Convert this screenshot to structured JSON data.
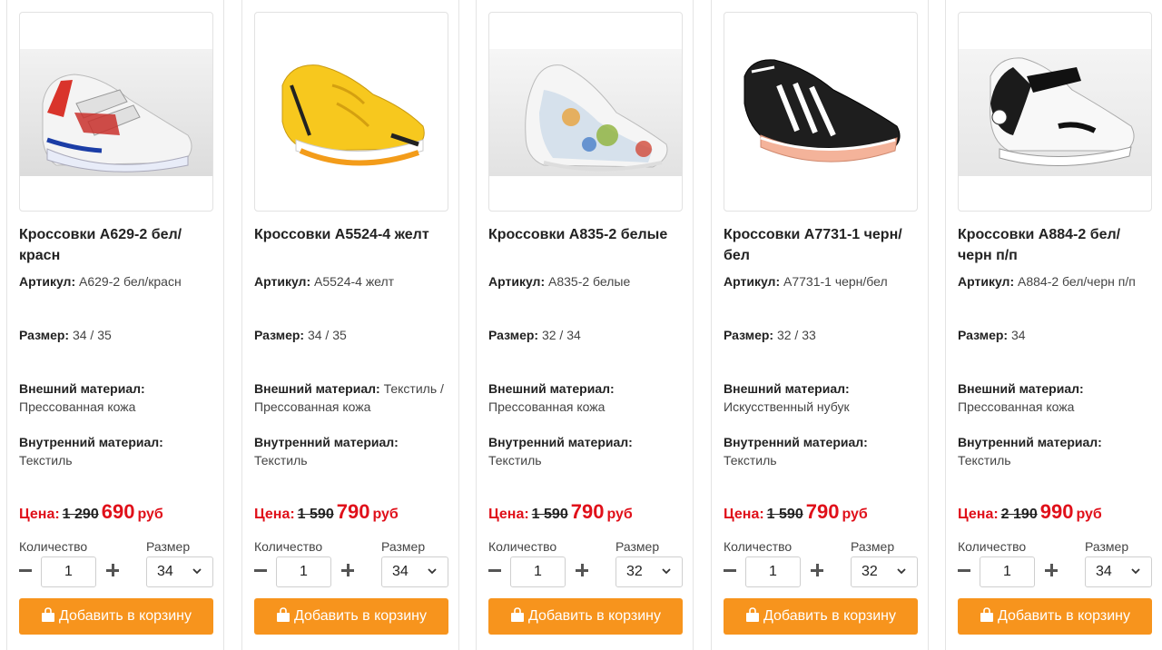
{
  "labels": {
    "article": "Артикул:",
    "size": "Размер:",
    "outer": "Внешний материал:",
    "inner": "Внутренний материал:",
    "price": "Цена:",
    "currency": "руб",
    "qty_label": "Количество",
    "size_label": "Размер",
    "cart_button": "Добавить в корзину"
  },
  "colors": {
    "accent": "#f7941d",
    "price_red": "#e0101a"
  },
  "products": [
    {
      "title": "Кроссовки А629-2 бел/красн",
      "article": "А629-2 бел/красн",
      "sizes": "34 / 35",
      "outer": "Прессованная кожа",
      "inner": "Текстиль",
      "old_price": "1 290",
      "new_price": "690",
      "quantity": "1",
      "selected_size": "34",
      "image": "white-red-velcro-sneaker"
    },
    {
      "title": "Кроссовки А5524-4 желт",
      "article": "А5524-4 желт",
      "sizes": "34 / 35",
      "outer": "Текстиль / Прессованная кожа",
      "inner": "Текстиль",
      "old_price": "1 590",
      "new_price": "790",
      "quantity": "1",
      "selected_size": "34",
      "image": "yellow-sneaker"
    },
    {
      "title": "Кроссовки А835-2 белые",
      "article": "А835-2 белые",
      "sizes": "32 / 34",
      "outer": "Прессованная кожа",
      "inner": "Текстиль",
      "old_price": "1 590",
      "new_price": "790",
      "quantity": "1",
      "selected_size": "32",
      "image": "graffiti-white-sneaker"
    },
    {
      "title": "Кроссовки А7731-1 черн/бел",
      "article": "А7731-1 черн/бел",
      "sizes": "32 / 33",
      "outer": "Искусственный нубук",
      "inner": "Текстиль",
      "old_price": "1 590",
      "new_price": "790",
      "quantity": "1",
      "selected_size": "32",
      "image": "black-white-striped-sneaker"
    },
    {
      "title": "Кроссовки А884-2 бел/черн п/п",
      "article": "А884-2 бел/черн п/п",
      "sizes": "34",
      "outer": "Прессованная кожа",
      "inner": "Текстиль",
      "old_price": "2 190",
      "new_price": "990",
      "quantity": "1",
      "selected_size": "34",
      "image": "white-black-velcro-sneaker"
    }
  ]
}
